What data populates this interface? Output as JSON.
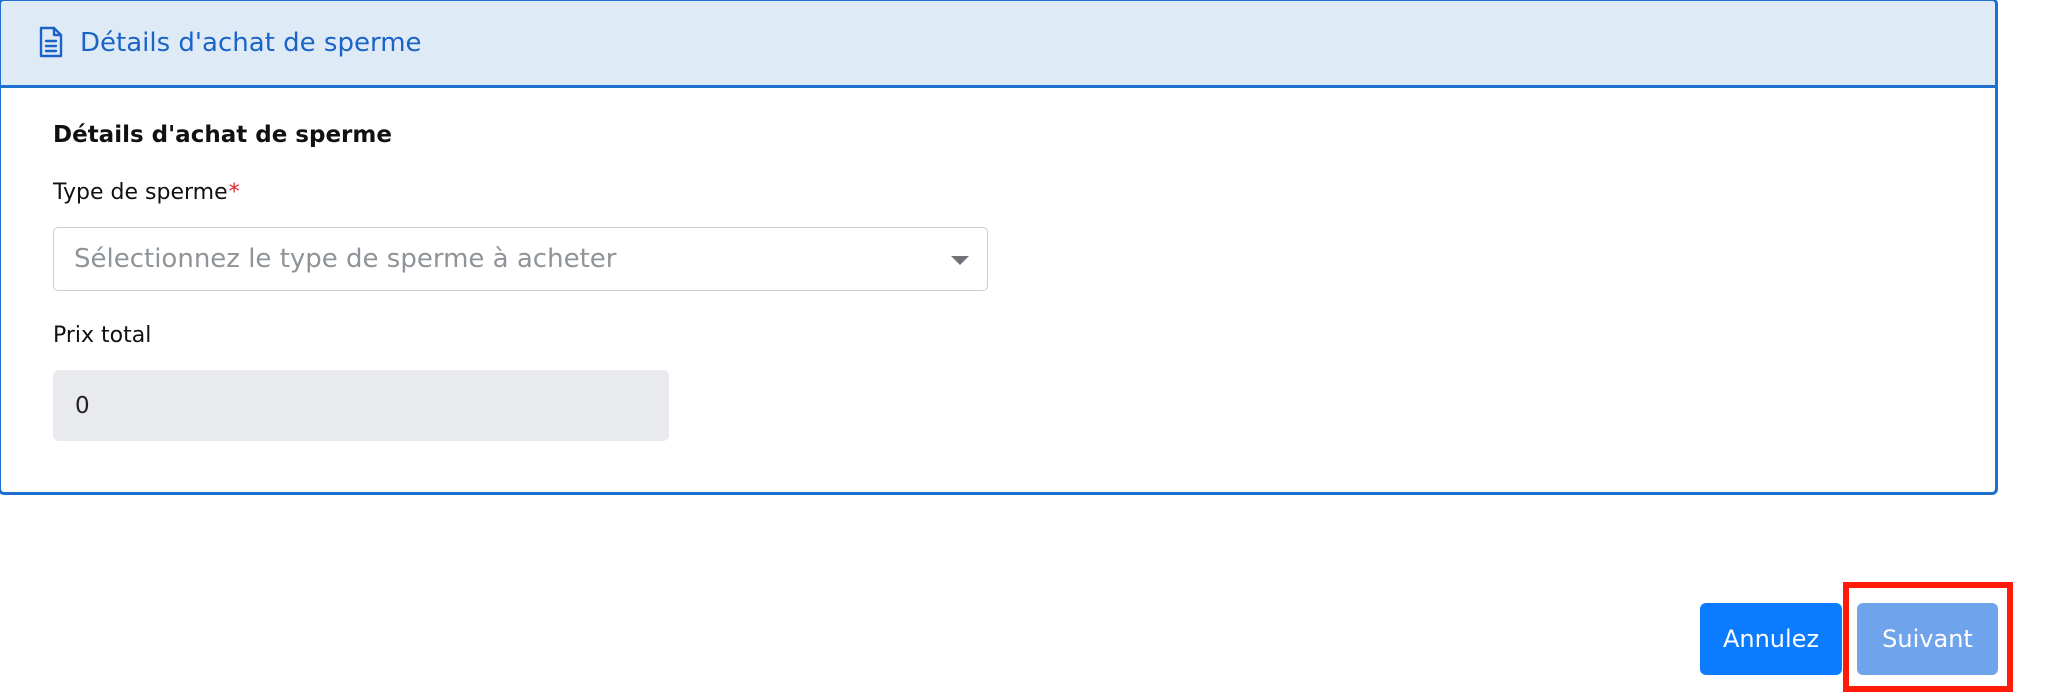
{
  "card": {
    "header_title": "Détails d'achat de sperme",
    "header_icon": "document-icon",
    "section_title": "Détails d'achat de sperme"
  },
  "form": {
    "type_label": "Type de sperme",
    "required_marker": "*",
    "type_placeholder": "Sélectionnez le type de sperme à acheter",
    "price_label": "Prix total",
    "price_value": "0"
  },
  "actions": {
    "cancel_label": "Annulez",
    "next_label": "Suivant"
  },
  "colors": {
    "accent": "#1f6fd1",
    "header_bg": "#dfeaf7",
    "cancel_bg": "#0b7bff",
    "next_bg_disabled": "#6fa3ec",
    "highlight": "#ff1a0a",
    "required": "#e0262e"
  }
}
